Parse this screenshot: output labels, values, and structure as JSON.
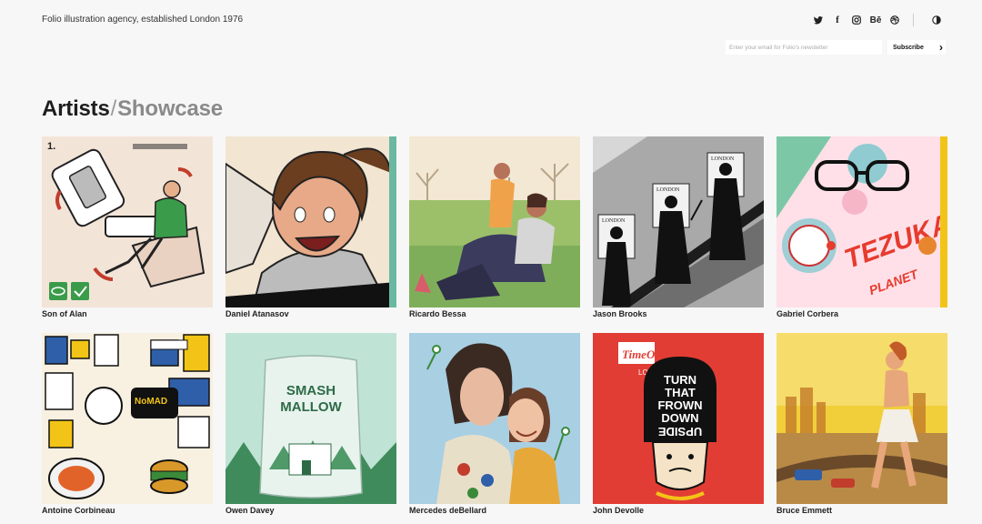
{
  "header": {
    "tagline": "Folio illustration agency, established London 1976",
    "social": [
      {
        "icon": "twitter-icon",
        "glyph": "🐦"
      },
      {
        "icon": "facebook-icon",
        "glyph": "f"
      },
      {
        "icon": "instagram-icon",
        "glyph": "◎"
      },
      {
        "icon": "behance-icon",
        "glyph": "Bē"
      },
      {
        "icon": "dribbble-icon",
        "glyph": "⊛"
      }
    ],
    "theme_toggle_glyph": "◐",
    "newsletter": {
      "placeholder": "Enter your email for Folio's newsletter",
      "button_label": "Subscribe",
      "button_arrow": "›"
    }
  },
  "page": {
    "title_artists": "Artists",
    "title_slash": "/",
    "title_showcase": "Showcase"
  },
  "artists": [
    {
      "name": "Son of Alan",
      "colors": [
        "#f3e4d8",
        "#3a9c4a",
        "#c23d2c"
      ]
    },
    {
      "name": "Daniel Atanasov",
      "colors": [
        "#d9c8b6",
        "#6b3e1f",
        "#e7a987"
      ]
    },
    {
      "name": "Ricardo Bessa",
      "colors": [
        "#eadbb7",
        "#7fae5a",
        "#3b3b5e"
      ]
    },
    {
      "name": "Jason Brooks",
      "colors": [
        "#a9a9a9",
        "#1c1c1c",
        "#f2f2f2"
      ]
    },
    {
      "name": "Gabriel Corbera",
      "colors": [
        "#ffe0e8",
        "#e63b2e",
        "#5fc2c8"
      ]
    },
    {
      "name": "Antoine Corbineau",
      "colors": [
        "#f8f0e0",
        "#2f5fa8",
        "#f2c417"
      ]
    },
    {
      "name": "Owen Davey",
      "colors": [
        "#bfe3d4",
        "#3f8b5b",
        "#e8f3ee"
      ]
    },
    {
      "name": "Mercedes deBellard",
      "colors": [
        "#a9cfe3",
        "#6a3f2a",
        "#e8dfc9"
      ]
    },
    {
      "name": "John Devolle",
      "colors": [
        "#e23d34",
        "#111111",
        "#f4e3c6"
      ]
    },
    {
      "name": "Bruce Emmett",
      "colors": [
        "#f1cf3b",
        "#c47c2a",
        "#6b4a2a"
      ]
    }
  ]
}
